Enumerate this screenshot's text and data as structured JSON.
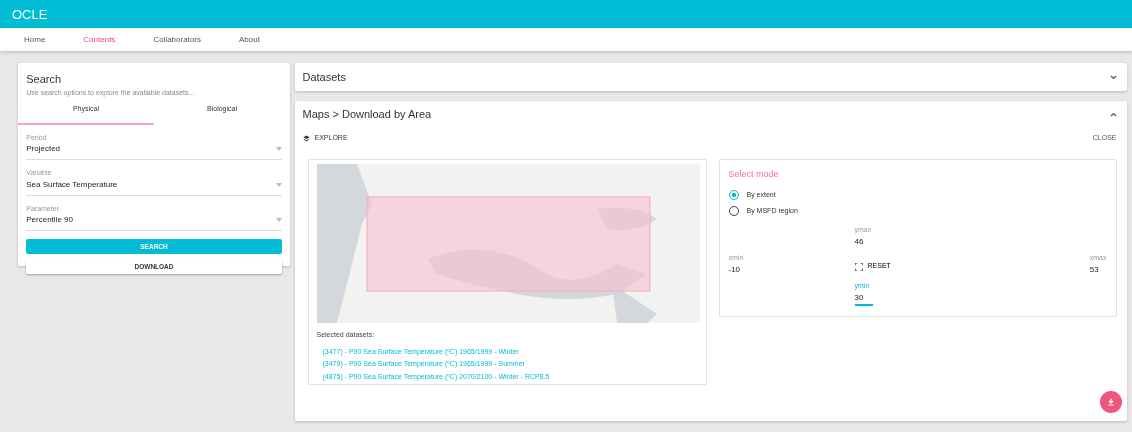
{
  "app_bar": {
    "title": "OCLE"
  },
  "nav": [
    {
      "label": "Home",
      "selected": false
    },
    {
      "label": "Contents",
      "selected": true
    },
    {
      "label": "Collaborators",
      "selected": false
    },
    {
      "label": "About",
      "selected": false
    }
  ],
  "search_panel": {
    "title": "Search",
    "subtitle": "Use search options to explore the available datasets...",
    "tabs": [
      {
        "label": "Physical",
        "selected": true
      },
      {
        "label": "Biological",
        "selected": false
      }
    ],
    "fields": [
      {
        "label": "Period",
        "value": "Projected"
      },
      {
        "label": "Variable",
        "value": "Sea Surface Temperature"
      },
      {
        "label": "Parameter",
        "value": "Percentile 90"
      }
    ],
    "buttons": [
      {
        "label": "SEARCH",
        "kind": "primary"
      },
      {
        "label": "DOWNLOAD",
        "kind": "outline"
      }
    ]
  },
  "datasets_panel": {
    "title": "Datasets",
    "expanded": false
  },
  "maps_panel": {
    "title": "Maps > Download by Area",
    "expanded": true,
    "explore_label": "EXPLORE",
    "close_label": "CLOSE",
    "selected_datasets_label": "Selected datasets:",
    "datasets": [
      "(3477) - P90 Sea Surface Temperature (ºC) 1965/1999 - Winter",
      "(3479) - P90 Sea Surface Temperature (ºC) 1965/1999 - Summer",
      "(4875) - P90 Sea Surface Temperature (ºC) 2070/2100 - Winter - RCP8.5"
    ]
  },
  "select_mode": {
    "title": "Select mode",
    "options": [
      {
        "label": "By extent",
        "selected": true
      },
      {
        "label": "By MSFD region",
        "selected": false
      }
    ],
    "extent": [
      {
        "kind": "top",
        "label": "ymax",
        "value": "46",
        "focused": false
      },
      {
        "kind": "left",
        "label": "xmin",
        "value": "-10",
        "focused": false
      },
      {
        "kind": "right",
        "label": "xmax",
        "value": "53",
        "focused": false
      },
      {
        "kind": "bottom",
        "label": "ymin",
        "value": "30",
        "focused": true
      }
    ],
    "reset_label": "RESET"
  }
}
